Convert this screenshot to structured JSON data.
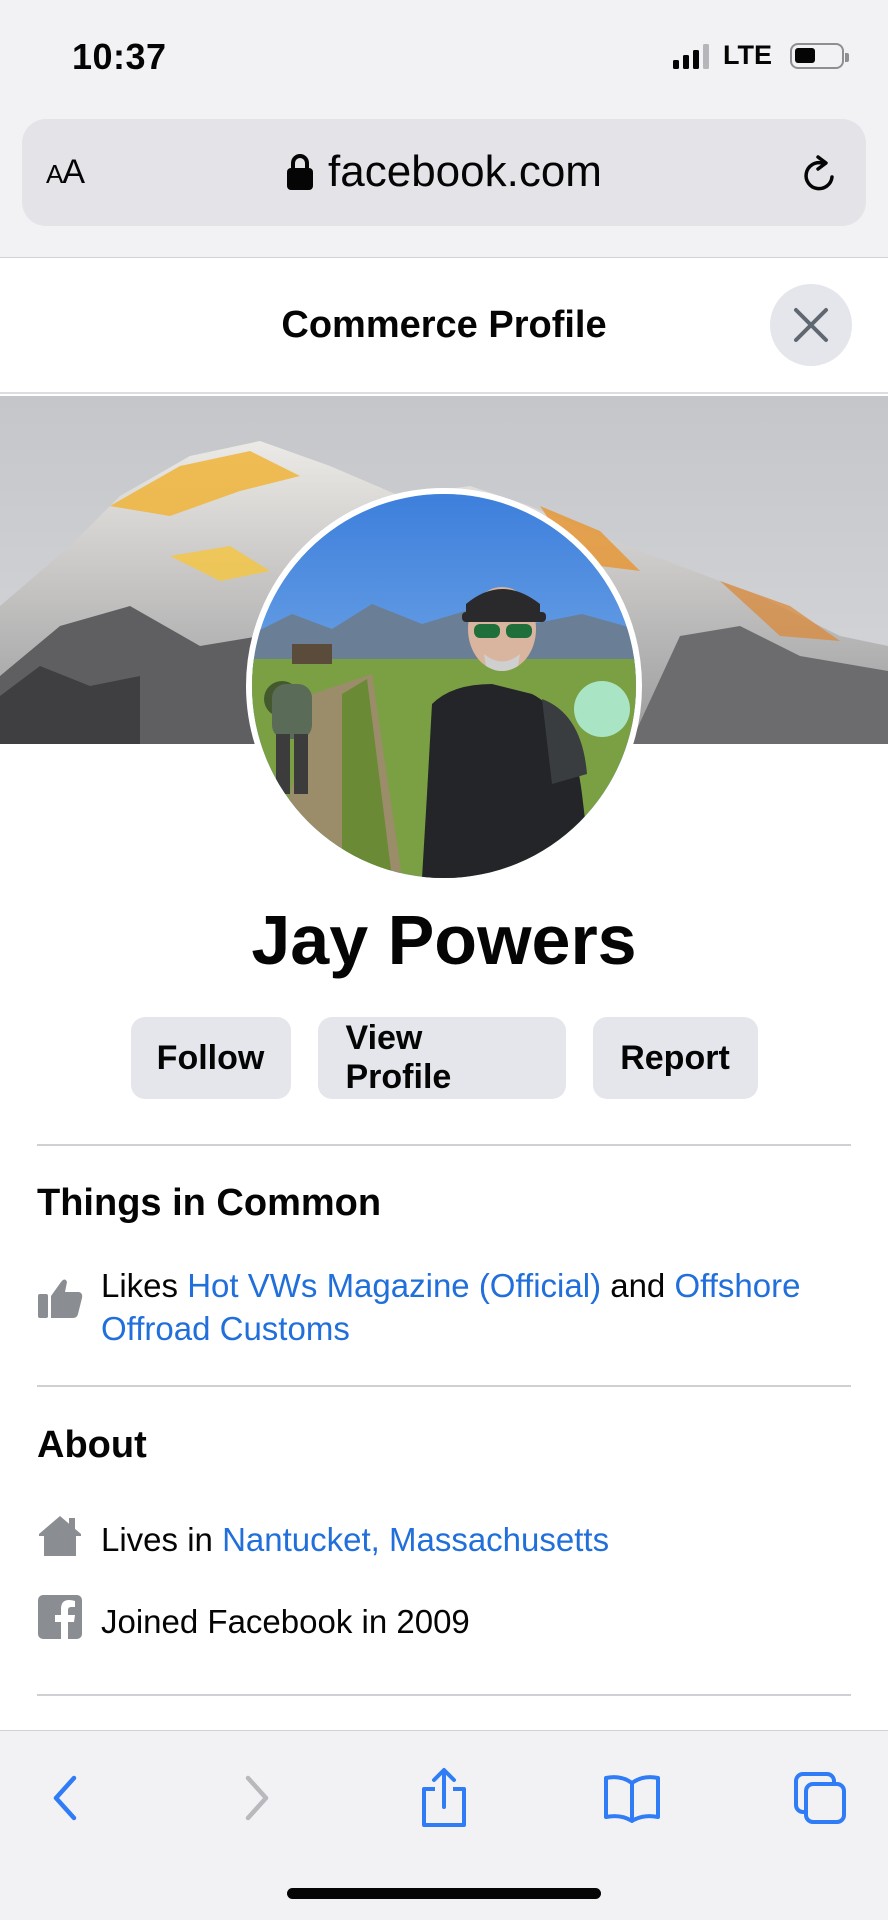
{
  "status_bar": {
    "time": "10:37",
    "network": "LTE"
  },
  "browser": {
    "text_size_label_small": "A",
    "text_size_label_large": "A",
    "url": "facebook.com"
  },
  "header": {
    "title": "Commerce Profile"
  },
  "profile": {
    "name": "Jay Powers"
  },
  "actions": {
    "follow": "Follow",
    "view_profile": "View Profile",
    "report": "Report"
  },
  "things_in_common": {
    "title": "Things in Common",
    "likes_prefix": "Likes ",
    "like_1": "Hot VWs Magazine (Official)",
    "conjunction": " and ",
    "like_2": "Offshore Offroad Customs"
  },
  "about": {
    "title": "About",
    "lives_prefix": "Lives in ",
    "location": "Nantucket, Massachusetts",
    "joined": "Joined Facebook in 2009"
  },
  "colors": {
    "link": "#216fdb",
    "icon_gray": "#8a8d91",
    "toolbar_blue": "#2f7cf6"
  },
  "icons": [
    "lock-icon",
    "reload-icon",
    "close-icon",
    "thumbs-up-icon",
    "home-icon",
    "facebook-icon",
    "back-icon",
    "forward-icon",
    "share-icon",
    "bookmarks-icon",
    "tabs-icon"
  ]
}
